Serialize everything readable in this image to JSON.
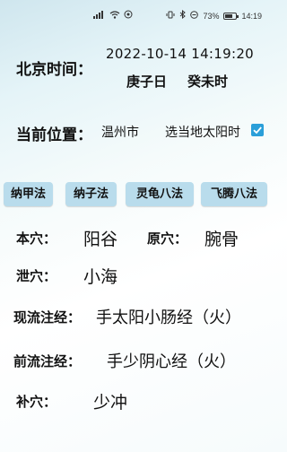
{
  "status_bar": {
    "left_icons": [
      "signal-icon",
      "wifi-icon",
      "nfc-icon"
    ],
    "battery_percent": "73%",
    "battery_level": 0.73,
    "time": "14:19"
  },
  "beijing_time": {
    "label": "北京时间：",
    "datetime": "2022-10-14 14:19:20",
    "day_ganzhi": "庚子日",
    "hour_ganzhi": "癸未时"
  },
  "location": {
    "label": "当前位置：",
    "city": "温州市",
    "local_sun_time_label": "选当地太阳时",
    "local_sun_time_checked": true,
    "accent_color": "#2b9fd9"
  },
  "tabs": [
    {
      "label": "纳甲法"
    },
    {
      "label": "纳子法"
    },
    {
      "label": "灵龟八法"
    },
    {
      "label": "飞腾八法"
    }
  ],
  "acupoints": {
    "ben_label": "本穴：",
    "ben_value": "阳谷",
    "yuan_label": "原穴：",
    "yuan_value": "腕骨",
    "xie_label": "泄穴：",
    "xie_value": "小海",
    "current_meridian_label": "现流注经：",
    "current_meridian_value": "手太阳小肠经（火）",
    "previous_meridian_label": "前流注经：",
    "previous_meridian_value": "手少阴心经（火）",
    "bu_label": "补穴：",
    "bu_value": "少冲"
  }
}
